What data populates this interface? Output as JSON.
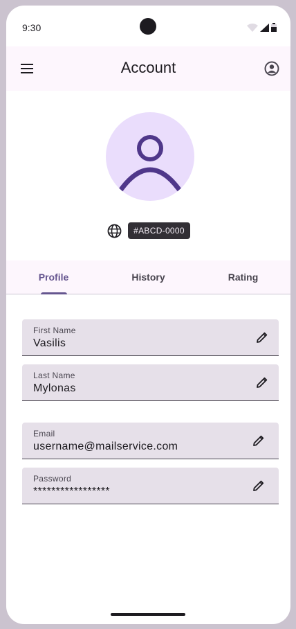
{
  "status_bar": {
    "time": "9:30"
  },
  "app_bar": {
    "title": "Account",
    "menu_icon": "menu-icon",
    "account_icon": "account-circle-icon"
  },
  "profile": {
    "user_id": "#ABCD-0000",
    "avatar_icon": "person-icon",
    "globe_icon": "globe-icon"
  },
  "tabs": [
    {
      "label": "Profile",
      "active": true
    },
    {
      "label": "History",
      "active": false
    },
    {
      "label": "Rating",
      "active": false
    }
  ],
  "fields": {
    "first_name": {
      "label": "First Name",
      "value": "Vasilis"
    },
    "last_name": {
      "label": "Last Name",
      "value": "Mylonas"
    },
    "email": {
      "label": "Email",
      "value": "username@mailservice.com"
    },
    "password": {
      "label": "Password",
      "value": "*****************"
    }
  },
  "colors": {
    "primary": "#65558f",
    "avatar_bg": "#eaddfc",
    "app_bar_bg": "#fdf6fd",
    "field_bg": "#e6e0e9"
  }
}
